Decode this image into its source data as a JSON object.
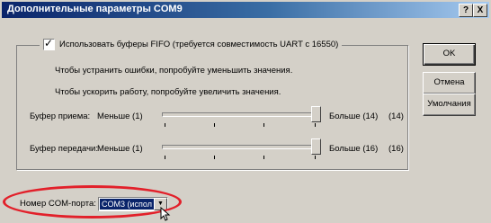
{
  "window": {
    "title": "Дополнительные параметры COM9",
    "help_glyph": "?",
    "close_glyph": "X"
  },
  "fifo": {
    "checked": true,
    "label": "Использовать буферы FIFO (требуется совместимость UART с 16550)",
    "hint_errors": "Чтобы устранить ошибки, попробуйте уменьшить значения.",
    "hint_speed": "Чтобы ускорить работу, попробуйте увеличить значения."
  },
  "receive_buffer": {
    "label": "Буфер приема:",
    "min_label": "Меньше (1)",
    "max_label": "Больше (14)",
    "current": "(14)",
    "level_fraction": 1.0
  },
  "transmit_buffer": {
    "label": "Буфер передачи:",
    "min_label": "Меньше (1)",
    "max_label": "Больше (16)",
    "current": "(16)",
    "level_fraction": 1.0
  },
  "buttons": {
    "ok": "OK",
    "cancel": "Отмена",
    "defaults": "Умолчания"
  },
  "com_port": {
    "label": "Номер COM-порта:",
    "selected": "COM3 (испол"
  },
  "colors": {
    "highlight_ring": "#e2202a",
    "titlebar": "#0a246a"
  }
}
